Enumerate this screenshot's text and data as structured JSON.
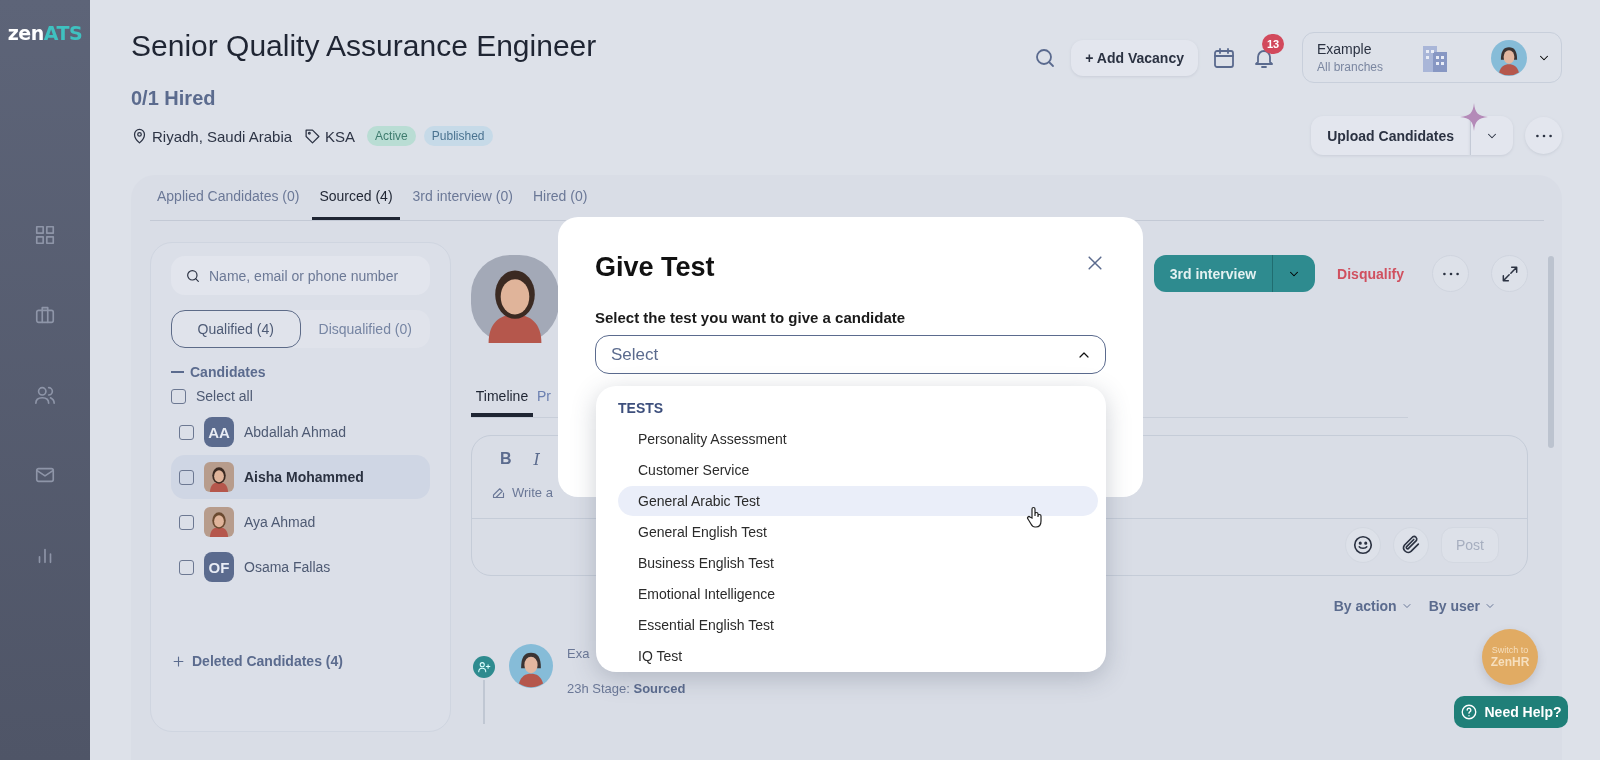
{
  "sidebar": {
    "logo": {
      "text": "zen",
      "accent": "ATS"
    }
  },
  "job": {
    "title": "Senior Quality Assurance Engineer",
    "hired": "0/1 Hired",
    "location": "Riyadh, Saudi Arabia",
    "tag": "KSA",
    "badges": [
      {
        "label": "Active",
        "color": "#b9ddd4"
      },
      {
        "label": "Published",
        "color": "#c6dae8"
      }
    ]
  },
  "topbar": {
    "add_vacancy": "+ Add Vacancy",
    "notifications": "13",
    "account": {
      "name": "Example",
      "subtitle": "All branches"
    },
    "upload": "Upload Candidates"
  },
  "pipeline_tabs": [
    {
      "label": "Applied Candidates (0)",
      "selected": false
    },
    {
      "label": "Sourced (4)",
      "selected": true
    },
    {
      "label": "3rd interview (0)",
      "selected": false
    },
    {
      "label": "Hired (0)",
      "selected": false
    }
  ],
  "candidates_panel": {
    "search_placeholder": "Name, email or phone number",
    "filters": [
      {
        "label": "Qualified (4)",
        "selected": true
      },
      {
        "label": "Disqualified (0)",
        "selected": false
      }
    ],
    "group": {
      "label": "Candidates",
      "expanded": true
    },
    "select_all": {
      "label": "Select all",
      "checked": false
    },
    "candidates": [
      {
        "name": "Abdallah Ahmad",
        "kind": "initials",
        "initials": "AA",
        "checked": false,
        "selected": false
      },
      {
        "name": "Aisha Mohammed",
        "kind": "photo",
        "checked": false,
        "selected": true
      },
      {
        "name": "Aya Ahmad",
        "kind": "photo",
        "checked": false,
        "selected": false
      },
      {
        "name": "Osama Fallas",
        "kind": "initials",
        "initials": "OF",
        "checked": false,
        "selected": false
      }
    ],
    "deleted": "Deleted Candidates (4)"
  },
  "candidate_detail": {
    "stage_button": "3rd interview",
    "disqualify": "Disqualify",
    "tabs": [
      {
        "label": "Timeline",
        "selected": true
      },
      {
        "label": "Pr",
        "selected": false
      }
    ],
    "editor": {
      "bold": "B",
      "italic": "I",
      "placeholder": "Write a",
      "post": "Post"
    },
    "filters": [
      "By action",
      "By user"
    ],
    "timeline": [
      {
        "title": "Exa",
        "line": "23h Stage: **Sourced**"
      }
    ]
  },
  "modal": {
    "title": "Give Test",
    "label": "Select the test you want to give a candidate",
    "placeholder": "Select",
    "expanded": true,
    "group": "TESTS",
    "options": [
      {
        "label": "Personality Assessment",
        "highlighted": false
      },
      {
        "label": "Customer Service",
        "highlighted": false
      },
      {
        "label": "General Arabic Test",
        "highlighted": true
      },
      {
        "label": "General English Test",
        "highlighted": false
      },
      {
        "label": "Business English Test",
        "highlighted": false
      },
      {
        "label": "Emotional Intelligence",
        "highlighted": false
      },
      {
        "label": "Essential English Test",
        "highlighted": false
      },
      {
        "label": "IQ Test",
        "highlighted": false
      }
    ]
  },
  "widgets": {
    "switch": [
      "Switch to",
      "ZenHR"
    ],
    "help": "Need Help?"
  }
}
